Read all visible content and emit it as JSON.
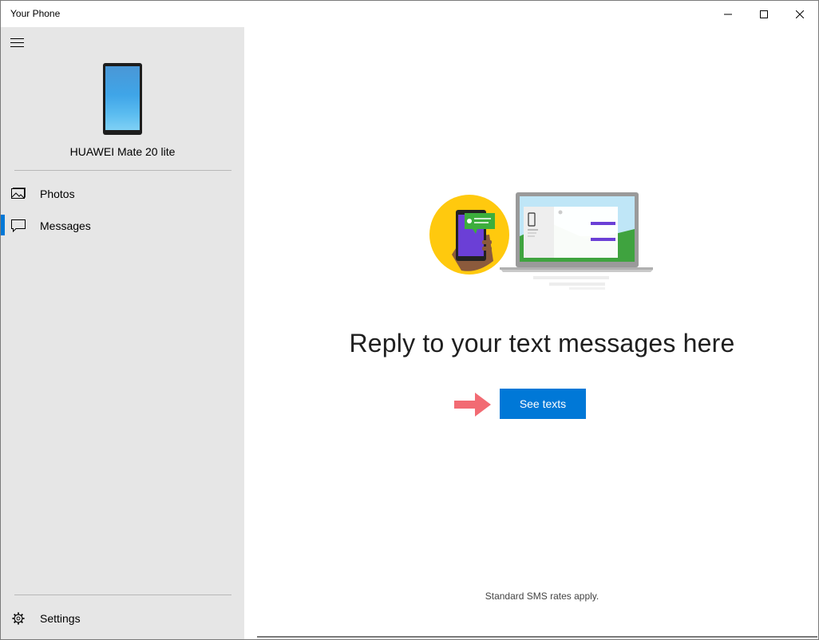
{
  "window": {
    "title": "Your Phone",
    "controls": {
      "minimize": "minimize-icon",
      "maximize": "maximize-icon",
      "close": "close-icon"
    }
  },
  "sidebar": {
    "device_name": "HUAWEI Mate 20 lite",
    "items": [
      {
        "label": "Photos",
        "icon": "photos-icon"
      },
      {
        "label": "Messages",
        "icon": "messages-icon",
        "active": true
      }
    ],
    "settings_label": "Settings"
  },
  "main": {
    "headline": "Reply to your text messages here",
    "cta_label": "See texts",
    "note": "Standard SMS rates apply."
  },
  "colors": {
    "accent": "#0078d7",
    "sidebar_bg": "#e6e6e6",
    "arrow": "#f26b73"
  }
}
